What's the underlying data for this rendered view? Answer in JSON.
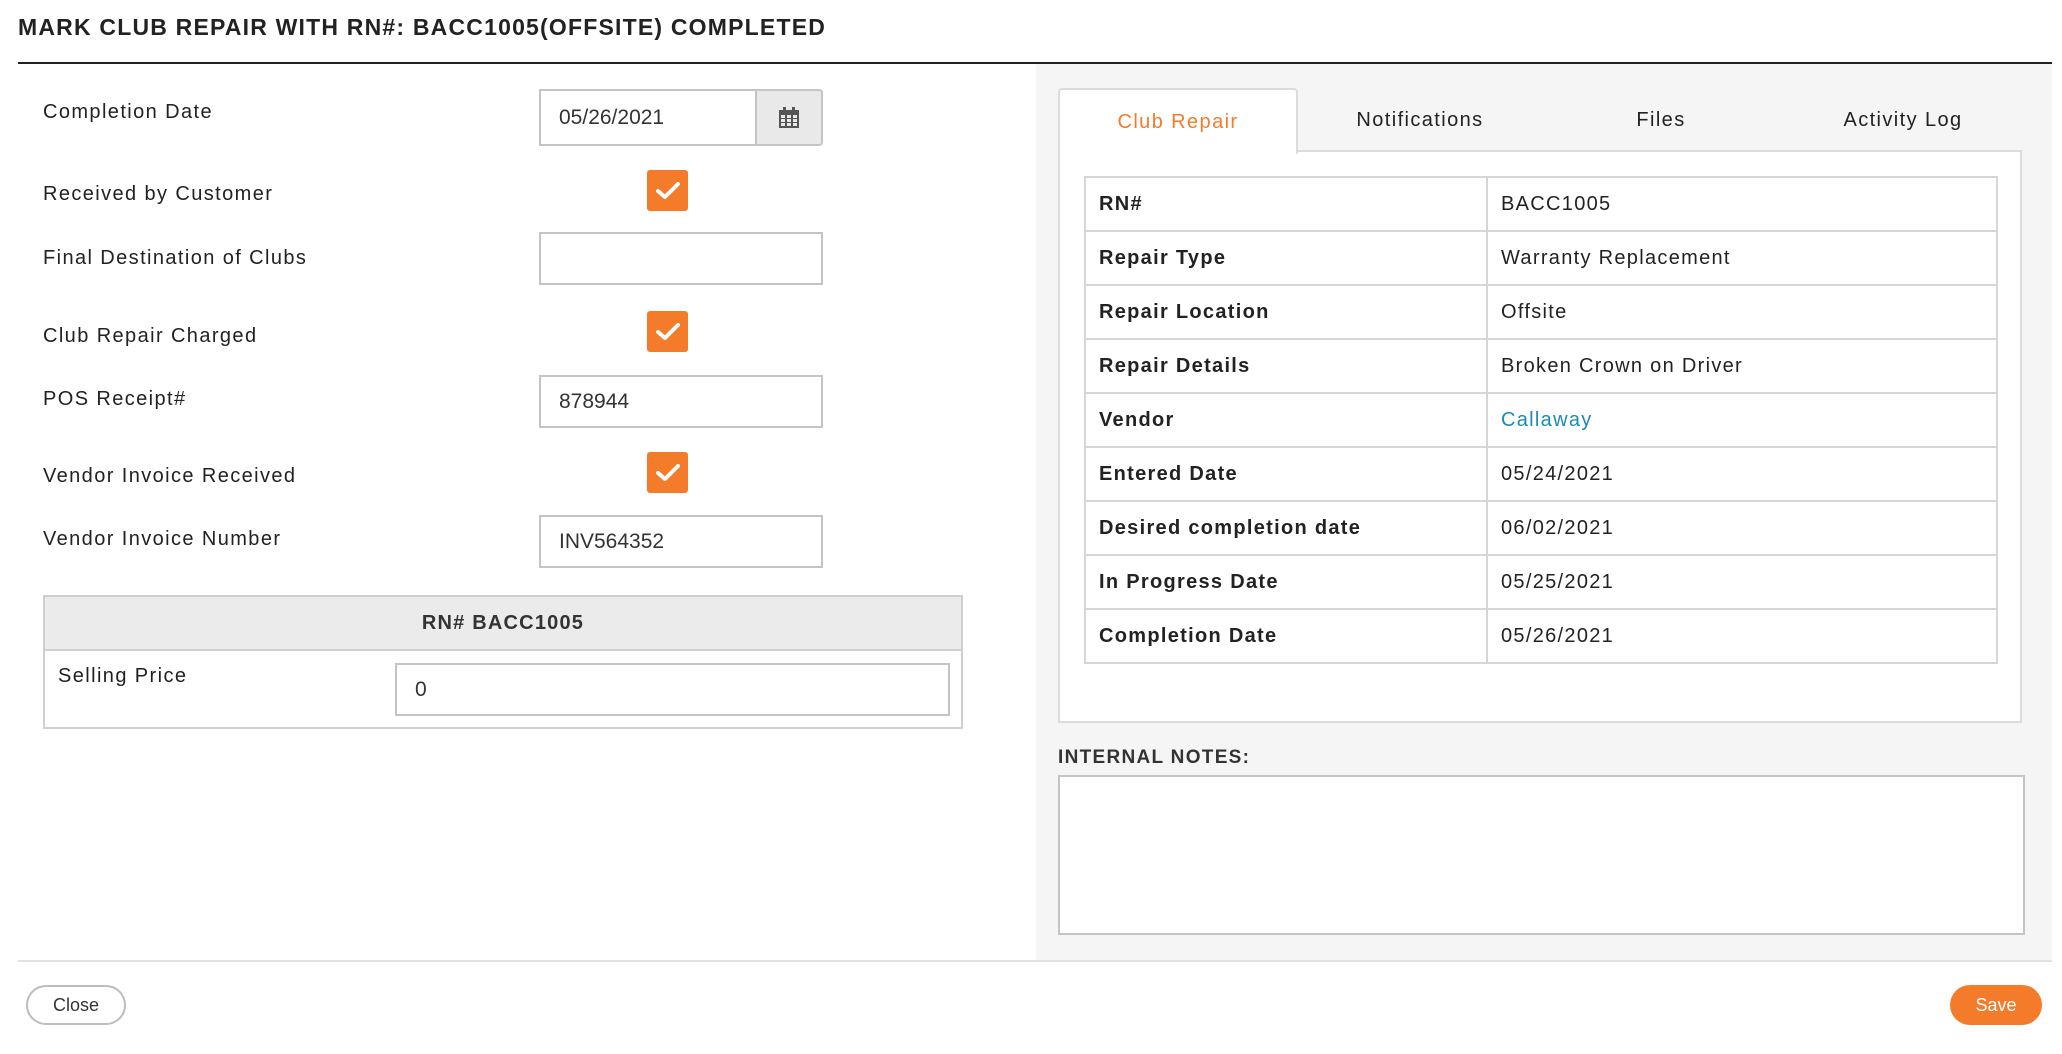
{
  "modal": {
    "title": "MARK CLUB REPAIR WITH RN#: BACC1005(OFFSITE) COMPLETED"
  },
  "form": {
    "completion_date_label": "Completion Date",
    "completion_date_value": "05/26/2021",
    "received_by_customer_label": "Received by Customer",
    "received_by_customer_checked": true,
    "final_destination_label": "Final Destination of Clubs",
    "final_destination_value": "",
    "club_repair_charged_label": "Club Repair Charged",
    "club_repair_charged_checked": true,
    "pos_receipt_label": "POS Receipt#",
    "pos_receipt_value": "878944",
    "vendor_invoice_received_label": "Vendor Invoice Received",
    "vendor_invoice_received_checked": true,
    "vendor_invoice_number_label": "Vendor Invoice Number",
    "vendor_invoice_number_value": "INV564352"
  },
  "rn_box": {
    "header": "RN# BACC1005",
    "selling_price_label": "Selling Price",
    "selling_price_value": "0"
  },
  "tabs": [
    {
      "label": "Club Repair",
      "active": true
    },
    {
      "label": "Notifications",
      "active": false
    },
    {
      "label": "Files",
      "active": false
    },
    {
      "label": "Activity Log",
      "active": false
    }
  ],
  "details": [
    {
      "key": "RN#",
      "value": "BACC1005"
    },
    {
      "key": "Repair Type",
      "value": "Warranty Replacement"
    },
    {
      "key": "Repair Location",
      "value": "Offsite"
    },
    {
      "key": "Repair Details",
      "value": "Broken Crown on Driver"
    },
    {
      "key": "Vendor",
      "value": "Callaway"
    },
    {
      "key": "Entered Date",
      "value": "05/24/2021"
    },
    {
      "key": "Desired completion date",
      "value": "06/02/2021"
    },
    {
      "key": "In Progress Date",
      "value": "05/25/2021"
    },
    {
      "key": "Completion Date",
      "value": "05/26/2021"
    }
  ],
  "notes": {
    "label": "INTERNAL NOTES:",
    "value": ""
  },
  "footer": {
    "close_label": "Close",
    "save_label": "Save"
  },
  "colors": {
    "accent": "#f47b2a",
    "link": "#1d8ab3"
  }
}
